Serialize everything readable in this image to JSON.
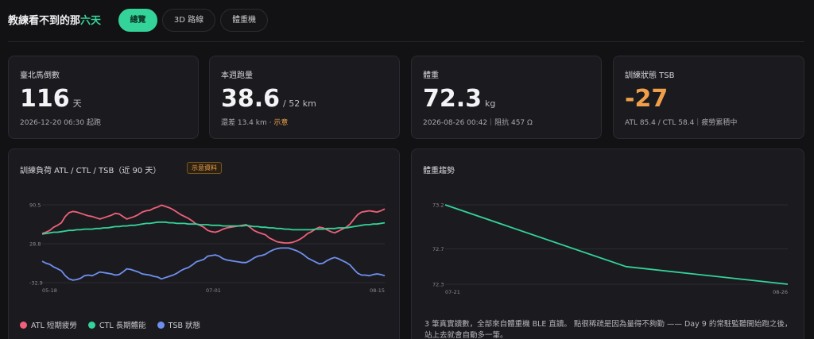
{
  "app": {
    "title_prefix": "教練看不到的那",
    "title_accent": "六天",
    "accent_color": "#34d399"
  },
  "tabs": [
    {
      "label": "總覽",
      "active": true
    },
    {
      "label": "3D 路線",
      "active": false
    },
    {
      "label": "體重機",
      "active": false
    }
  ],
  "stats": [
    {
      "label": "臺北馬倒數",
      "value": "116",
      "unit": "天",
      "sub": "2026-12-20 06:30 起跑",
      "hint": ""
    },
    {
      "label": "本週跑量",
      "value": "38.6",
      "unit": "/ 52 km",
      "sub": "還差 13.4 km · ",
      "hint": "示意"
    },
    {
      "label": "體重",
      "value": "72.3",
      "unit": "kg",
      "sub": "2026-08-26 00:42｜阻抗 457 Ω",
      "hint": ""
    },
    {
      "label": "訓練狀態 TSB",
      "value": "-27",
      "unit": "",
      "sub": "ATL 85.4 / CTL 58.4｜疲勞累積中",
      "hint": "",
      "value_color": "#f0a04b"
    }
  ],
  "load_panel": {
    "title": "訓練負荷 ATL / CTL / TSB（近 90 天）",
    "badge": "示意資料",
    "legend": [
      {
        "name": "ATL 短期疲勞",
        "color": "#f0607a"
      },
      {
        "name": "CTL 長期體能",
        "color": "#34d399"
      },
      {
        "name": "TSB 狀態",
        "color": "#6f8ff0"
      }
    ]
  },
  "weight_panel": {
    "title": "體重趨勢",
    "note": "3 筆真實讀數，全部來自體重機 BLE 直讀。 點很稀疏是因為量得不夠勤 —— Day 9 的常駐監聽開始跑之後，站上去就會自動多一筆。"
  },
  "chart_data": [
    {
      "type": "line",
      "title": "訓練負荷 ATL / CTL / TSB（近 90 天）",
      "x_ticks": [
        "05-18",
        "07-01",
        "08-15"
      ],
      "y_ticks": [
        90.5,
        28.8,
        -32.9
      ],
      "ylim": [
        -32.9,
        90.5
      ],
      "grid": true,
      "legend_position": "bottom-left",
      "x_count": 90,
      "x": [
        1,
        2,
        3,
        4,
        5,
        6,
        7,
        8,
        9,
        10,
        11,
        12,
        13,
        14,
        15,
        16,
        17,
        18,
        19,
        20,
        21,
        22,
        23,
        24,
        25,
        26,
        27,
        28,
        29,
        30,
        31,
        32,
        33,
        34,
        35,
        36,
        37,
        38,
        39,
        40,
        41,
        42,
        43,
        44,
        45,
        46,
        47,
        48,
        49,
        50,
        51,
        52,
        53,
        54,
        55,
        56,
        57,
        58,
        59,
        60,
        61,
        62,
        63,
        64,
        65,
        66,
        67,
        68,
        69,
        70,
        71,
        72,
        73,
        74,
        75,
        76,
        77,
        78,
        79,
        80,
        81,
        82,
        83,
        84,
        85,
        86,
        87,
        88,
        89,
        90
      ],
      "series": [
        {
          "name": "ATL 短期疲勞",
          "color": "#f0607a",
          "values": [
            45,
            47,
            50,
            55,
            58,
            62,
            72,
            78,
            80,
            79,
            77,
            75,
            73,
            72,
            70,
            68,
            70,
            72,
            74,
            77,
            76,
            72,
            68,
            70,
            72,
            75,
            79,
            81,
            82,
            85,
            87,
            90,
            88,
            86,
            83,
            79,
            75,
            72,
            69,
            65,
            60,
            58,
            55,
            50,
            48,
            47,
            49,
            52,
            54,
            55,
            56,
            57,
            58,
            59,
            55,
            50,
            47,
            45,
            43,
            38,
            35,
            32,
            31,
            30,
            30,
            31,
            33,
            36,
            40,
            45,
            48,
            52,
            55,
            54,
            51,
            48,
            46,
            49,
            52,
            55,
            60,
            68,
            75,
            79,
            80,
            81,
            80,
            79,
            81,
            84
          ]
        },
        {
          "name": "CTL 長期體能",
          "color": "#34d399",
          "values": [
            44,
            45,
            46,
            47,
            47,
            48,
            49,
            50,
            50,
            51,
            51,
            52,
            52,
            52,
            53,
            53,
            54,
            54,
            55,
            56,
            56,
            57,
            57,
            58,
            58,
            59,
            60,
            61,
            61,
            62,
            63,
            63,
            63,
            62,
            62,
            61,
            61,
            61,
            60,
            60,
            60,
            59,
            59,
            59,
            58,
            58,
            58,
            57,
            57,
            57,
            57,
            57,
            57,
            58,
            57,
            56,
            56,
            55,
            55,
            54,
            54,
            53,
            53,
            52,
            52,
            51,
            51,
            51,
            51,
            51,
            51,
            52,
            52,
            52,
            53,
            53,
            53,
            54,
            54,
            54,
            55,
            56,
            57,
            58,
            59,
            59,
            60,
            60,
            61,
            62
          ]
        },
        {
          "name": "TSB 狀態",
          "color": "#6f8ff0",
          "values": [
            1,
            -2,
            -4,
            -8,
            -11,
            -14,
            -22,
            -27,
            -29,
            -28,
            -26,
            -22,
            -21,
            -22,
            -19,
            -16,
            -17,
            -18,
            -19,
            -21,
            -20,
            -16,
            -11,
            -12,
            -14,
            -16,
            -19,
            -20,
            -21,
            -23,
            -24,
            -27,
            -25,
            -23,
            -21,
            -18,
            -14,
            -11,
            -9,
            -5,
            0,
            2,
            4,
            9,
            10,
            11,
            9,
            5,
            3,
            2,
            1,
            0,
            -1,
            -1,
            2,
            6,
            9,
            10,
            12,
            16,
            19,
            21,
            22,
            22,
            22,
            20,
            18,
            15,
            11,
            6,
            3,
            0,
            -3,
            -2,
            2,
            5,
            7,
            5,
            2,
            -1,
            -5,
            -12,
            -18,
            -21,
            -21,
            -22,
            -20,
            -19,
            -20,
            -22
          ]
        }
      ]
    },
    {
      "type": "line",
      "title": "體重趨勢",
      "x_ticks": [
        "07-21",
        "08-26"
      ],
      "y_ticks": [
        73.2,
        72.7,
        72.3
      ],
      "ylim": [
        72.3,
        73.2
      ],
      "grid": true,
      "x_dates": [
        "07-21",
        "08-09",
        "08-26"
      ],
      "x": [
        0,
        19,
        36
      ],
      "series": [
        {
          "name": "",
          "color": "#34d399",
          "values": [
            73.2,
            72.5,
            72.3
          ]
        }
      ]
    }
  ]
}
